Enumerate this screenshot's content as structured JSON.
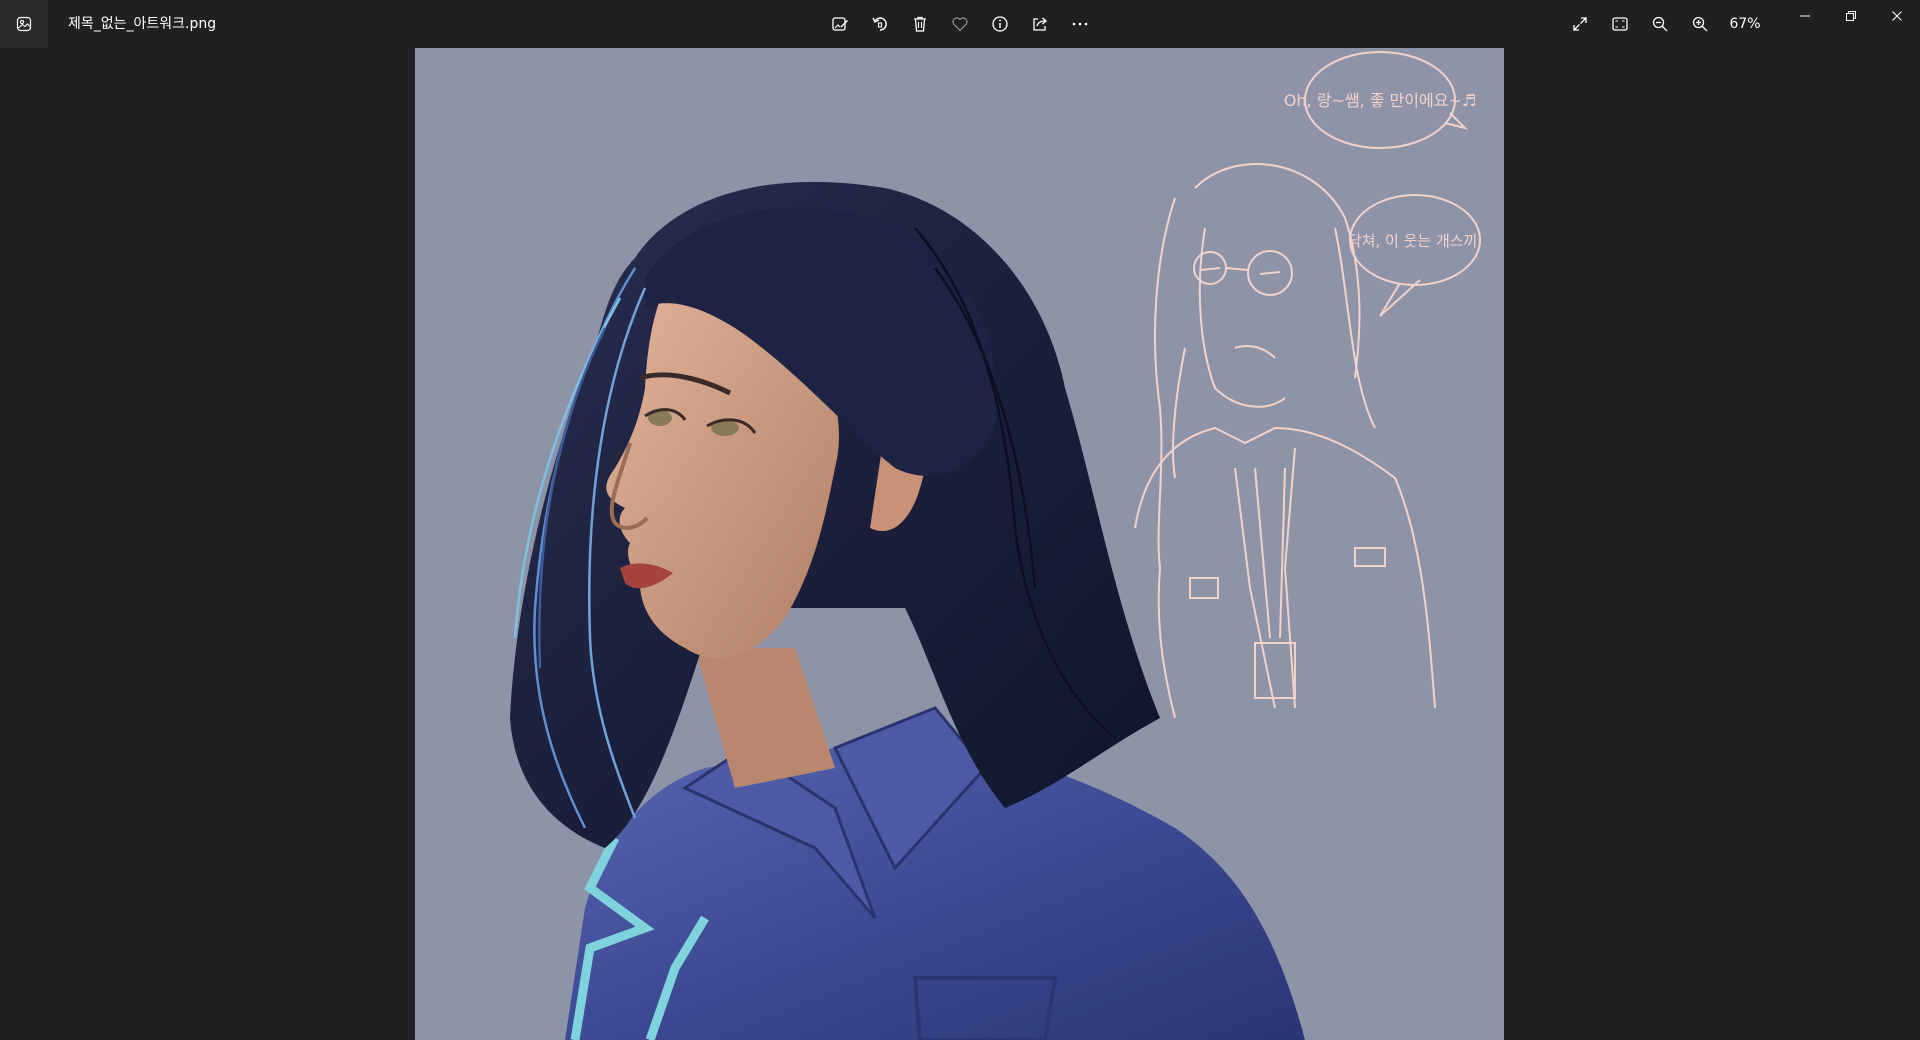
{
  "window": {
    "file_name": "제목_없는_아트워크.png",
    "app_icon": "photos-app-icon"
  },
  "toolbar": {
    "buttons": [
      {
        "name": "edit-image-button",
        "icon": "edit-image-icon"
      },
      {
        "name": "rotate-button",
        "icon": "rotate-icon"
      },
      {
        "name": "delete-button",
        "icon": "trash-icon"
      },
      {
        "name": "favorite-button",
        "icon": "heart-icon"
      },
      {
        "name": "file-info-button",
        "icon": "info-icon"
      },
      {
        "name": "share-button",
        "icon": "share-icon"
      },
      {
        "name": "more-options-button",
        "icon": "ellipsis-icon"
      }
    ]
  },
  "view_tools": {
    "fullscreen_icon": "expand-icon",
    "fit_icon": "fit-to-window-icon",
    "zoom_out_icon": "zoom-out-icon",
    "zoom_in_icon": "zoom-in-icon",
    "zoom_level": "67%"
  },
  "window_controls": {
    "minimize_icon": "minimize-icon",
    "restore_icon": "restore-icon",
    "close_icon": "close-icon"
  },
  "image": {
    "sketch_bubble_1": "Oh, 랑~쌤, 좋 만이에요~♬",
    "sketch_bubble_2": "닥쳐, 이 웃는 개스끼.",
    "colors": {
      "background": "#8f93a8",
      "hair": "#1d2240",
      "shirt": "#3d4a94",
      "skin": "#c99a80",
      "sketch_line": "#f1d3cc",
      "accent_cyan": "#7fd3dc"
    }
  }
}
